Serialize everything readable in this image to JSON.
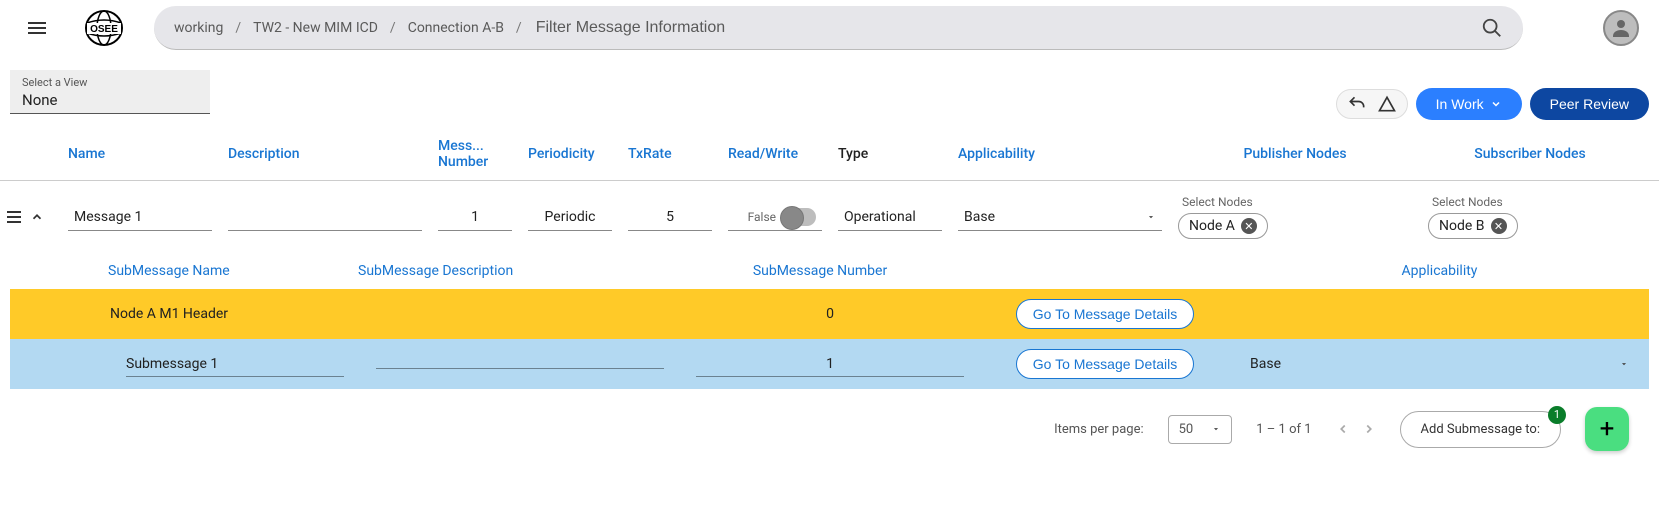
{
  "header": {
    "logo_text": "OSEE",
    "breadcrumbs": [
      "working",
      "TW2 - New MIM ICD",
      "Connection A-B"
    ],
    "filter_placeholder": "Filter Message Information"
  },
  "view": {
    "label": "Select a View",
    "value": "None"
  },
  "actions": {
    "in_work": "In Work",
    "peer_review": "Peer Review"
  },
  "columns": {
    "name": "Name",
    "description": "Description",
    "mess_number_a": "Mess...",
    "mess_number_b": "Number",
    "periodicity": "Periodicity",
    "txrate": "TxRate",
    "readwrite": "Read/Write",
    "type": "Type",
    "applicability": "Applicability",
    "publisher": "Publisher Nodes",
    "subscriber": "Subscriber Nodes"
  },
  "message": {
    "name": "Message 1",
    "number": "1",
    "periodicity": "Periodic",
    "txrate": "5",
    "rw_label": "False",
    "type": "Operational",
    "applicability": "Base",
    "select_nodes_label": "Select Nodes",
    "publisher_chip": "Node A",
    "subscriber_chip": "Node B"
  },
  "sub_columns": {
    "name": "SubMessage Name",
    "desc": "SubMessage Description",
    "number": "SubMessage Number",
    "applic": "Applicability"
  },
  "sub_rows": [
    {
      "name": "Node A M1 Header",
      "number": "0",
      "goto": "Go To Message Details",
      "applic": ""
    },
    {
      "name": "Submessage 1",
      "number": "1",
      "goto": "Go To Message Details",
      "applic": "Base"
    }
  ],
  "paginator": {
    "items_label": "Items per page:",
    "page_size": "50",
    "range": "1 – 1 of 1",
    "add_sub": "Add Submessage to:",
    "badge": "1"
  }
}
